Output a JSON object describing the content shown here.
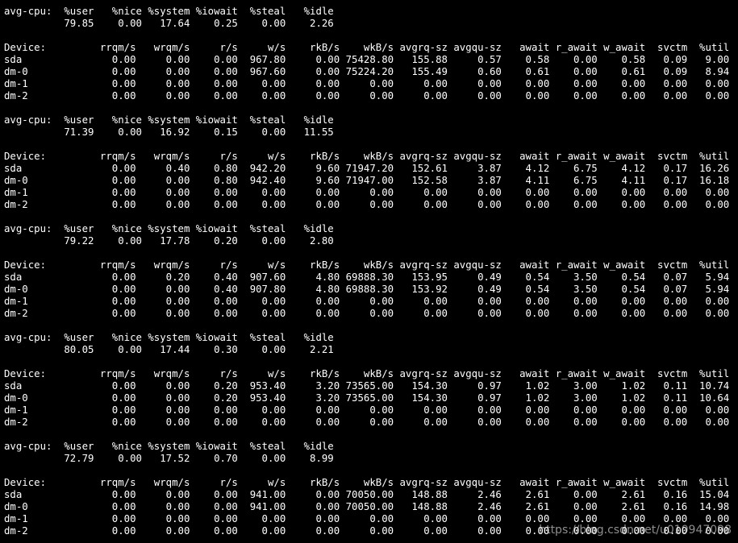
{
  "colors": {
    "background": "#000000",
    "foreground": "#ffffff"
  },
  "terminal": {
    "lines": [
      "avg-cpu:  %user   %nice %system %iowait  %steal   %idle",
      "          79.85    0.00   17.64    0.25    0.00    2.26",
      "",
      "Device:         rrqm/s   wrqm/s     r/s     w/s    rkB/s    wkB/s avgrq-sz avgqu-sz   await r_await w_await  svctm  %util",
      "sda               0.00     0.00    0.00  967.80     0.00 75428.80   155.88     0.57    0.58    0.00    0.58   0.09   9.00",
      "dm-0              0.00     0.00    0.00  967.60     0.00 75224.20   155.49     0.60    0.61    0.00    0.61   0.09   8.94",
      "dm-1              0.00     0.00    0.00    0.00     0.00     0.00     0.00     0.00    0.00    0.00    0.00   0.00   0.00",
      "dm-2              0.00     0.00    0.00    0.00     0.00     0.00     0.00     0.00    0.00    0.00    0.00   0.00   0.00",
      "",
      "avg-cpu:  %user   %nice %system %iowait  %steal   %idle",
      "          71.39    0.00   16.92    0.15    0.00   11.55",
      "",
      "Device:         rrqm/s   wrqm/s     r/s     w/s    rkB/s    wkB/s avgrq-sz avgqu-sz   await r_await w_await  svctm  %util",
      "sda               0.00     0.40    0.80  942.20     9.60 71947.20   152.61     3.87    4.12    6.75    4.12   0.17  16.26",
      "dm-0              0.00     0.00    0.80  942.40     9.60 71947.00   152.58     3.87    4.11    6.75    4.11   0.17  16.18",
      "dm-1              0.00     0.00    0.00    0.00     0.00     0.00     0.00     0.00    0.00    0.00    0.00   0.00   0.00",
      "dm-2              0.00     0.00    0.00    0.00     0.00     0.00     0.00     0.00    0.00    0.00    0.00   0.00   0.00",
      "",
      "avg-cpu:  %user   %nice %system %iowait  %steal   %idle",
      "          79.22    0.00   17.78    0.20    0.00    2.80",
      "",
      "Device:         rrqm/s   wrqm/s     r/s     w/s    rkB/s    wkB/s avgrq-sz avgqu-sz   await r_await w_await  svctm  %util",
      "sda               0.00     0.20    0.40  907.60     4.80 69888.30   153.95     0.49    0.54    3.50    0.54   0.07   5.94",
      "dm-0              0.00     0.00    0.40  907.80     4.80 69888.30   153.92     0.49    0.54    3.50    0.54   0.07   5.94",
      "dm-1              0.00     0.00    0.00    0.00     0.00     0.00     0.00     0.00    0.00    0.00    0.00   0.00   0.00",
      "dm-2              0.00     0.00    0.00    0.00     0.00     0.00     0.00     0.00    0.00    0.00    0.00   0.00   0.00",
      "",
      "avg-cpu:  %user   %nice %system %iowait  %steal   %idle",
      "          80.05    0.00   17.44    0.30    0.00    2.21",
      "",
      "Device:         rrqm/s   wrqm/s     r/s     w/s    rkB/s    wkB/s avgrq-sz avgqu-sz   await r_await w_await  svctm  %util",
      "sda               0.00     0.00    0.20  953.40     3.20 73565.00   154.30     0.97    1.02    3.00    1.02   0.11  10.74",
      "dm-0              0.00     0.00    0.20  953.40     3.20 73565.00   154.30     0.97    1.02    3.00    1.02   0.11  10.64",
      "dm-1              0.00     0.00    0.00    0.00     0.00     0.00     0.00     0.00    0.00    0.00    0.00   0.00   0.00",
      "dm-2              0.00     0.00    0.00    0.00     0.00     0.00     0.00     0.00    0.00    0.00    0.00   0.00   0.00",
      "",
      "avg-cpu:  %user   %nice %system %iowait  %steal   %idle",
      "          72.79    0.00   17.52    0.70    0.00    8.99",
      "",
      "Device:         rrqm/s   wrqm/s     r/s     w/s    rkB/s    wkB/s avgrq-sz avgqu-sz   await r_await w_await  svctm  %util",
      "sda               0.00     0.00    0.00  941.00     0.00 70050.00   148.88     2.46    2.61    0.00    2.61   0.16  15.04",
      "dm-0              0.00     0.00    0.00  941.00     0.00 70050.00   148.88     2.46    2.61    0.00    2.61   0.16  14.98",
      "dm-1              0.00     0.00    0.00    0.00     0.00     0.00     0.00     0.00    0.00    0.00    0.00   0.00   0.00",
      "dm-2              0.00     0.00    0.00    0.00     0.00     0.00     0.00     0.00    0.00    0.00    0.00   0.00   0.00"
    ]
  },
  "watermark": {
    "text": "https://blog.csdn.net/u010947098"
  }
}
